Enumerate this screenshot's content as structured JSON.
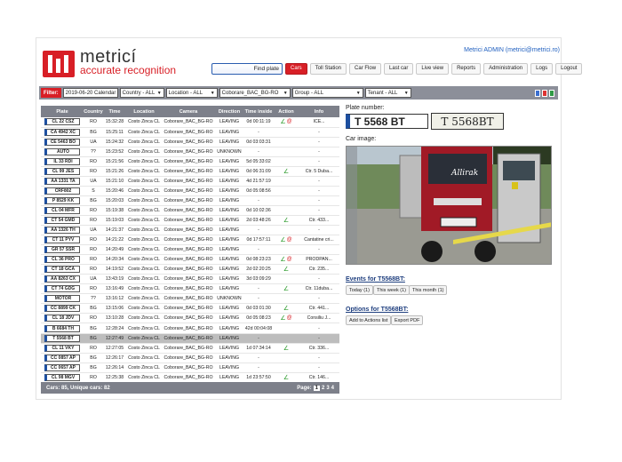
{
  "brand": {
    "name": "metricí",
    "tagline": "accurate recognition"
  },
  "user_link": "Metrici ADMIN (metrici@metrici.ro)",
  "search": {
    "label": "Find plate"
  },
  "nav": [
    "Cars",
    "Toll Station",
    "Car Flow",
    "Last car",
    "Live view",
    "Reports",
    "Administration",
    "Logs",
    "Logout"
  ],
  "filter": {
    "label": "Filter:",
    "date": "2019-06-20 Calendar",
    "country": "Country - ALL",
    "location": "Location - ALL",
    "camera": "Coborare_BAC_BG-RO",
    "group": "Group - ALL",
    "tenant": "Tenant - ALL"
  },
  "table": {
    "headers": [
      "Plate",
      "Country",
      "Time",
      "Location",
      "Camera",
      "Direction",
      "Time inside",
      "Action",
      "Info"
    ],
    "rows": [
      [
        "CL 22 CSZ",
        "RO",
        "15:32:28",
        "Costo Zinca CL",
        "Coborare_BAC_BG-RO",
        "LEAVING",
        "0d 00:11:19",
        "ok-mail",
        "ICE..."
      ],
      [
        "CA 4942 XC",
        "BG",
        "15:25:11",
        "Costo Zinca CL",
        "Coborare_BAC_BG-RO",
        "LEAVING",
        "-",
        "",
        "-"
      ],
      [
        "CE 5463 BO",
        "UA",
        "15:24:32",
        "Costo Zinca CL",
        "Coborare_BAC_BG-RO",
        "LEAVING",
        "0d 03:03:31",
        "",
        "-"
      ],
      [
        "AUTO",
        "??",
        "15:23:52",
        "Costo Zinca CL",
        "Coborare_BAC_BG-RO",
        "UNKNOWN",
        "-",
        "",
        "-"
      ],
      [
        "IL 33 RDI",
        "RO",
        "15:21:56",
        "Costo Zinca CL",
        "Coborare_BAC_BG-RO",
        "LEAVING",
        "5d 05:33:02",
        "",
        "-"
      ],
      [
        "CL 99 JES",
        "RO",
        "15:21:26",
        "Costo Zinca CL",
        "Coborare_BAC_BG-RO",
        "LEAVING",
        "0d 06:31:09",
        "ok",
        "Ctr. 5 Duba..."
      ],
      [
        "AA 1331 TA",
        "UA",
        "15:21:10",
        "Costo Zinca CL",
        "Coborare_BAC_BG-RO",
        "LEAVING",
        "4d 21:57:19",
        "",
        "-"
      ],
      [
        "CRF802",
        "S",
        "15:20:46",
        "Costo Zinca CL",
        "Coborare_BAC_BG-RO",
        "LEAVING",
        "0d 05:08:56",
        "",
        "-"
      ],
      [
        "P 8529 KK",
        "BG",
        "15:20:03",
        "Costo Zinca CL",
        "Coborare_BAC_BG-RO",
        "LEAVING",
        "-",
        "",
        "-"
      ],
      [
        "CL 04 MFR",
        "RO",
        "15:19:38",
        "Costo Zinca CL",
        "Coborare_BAC_BG-RO",
        "LEAVING",
        "0d 10:02:36",
        "",
        "-"
      ],
      [
        "CT 54 GMD",
        "RO",
        "15:19:03",
        "Costo Zinca CL",
        "Coborare_BAC_BG-RO",
        "LEAVING",
        "2d 03:48:26",
        "ok",
        "Ctr. 433..."
      ],
      [
        "AA 1326 TH",
        "UA",
        "14:21:37",
        "Costo Zinca CL",
        "Coborare_BAC_BG-RO",
        "LEAVING",
        "-",
        "",
        "-"
      ],
      [
        "CT 11 PYV",
        "RO",
        "14:21:22",
        "Costo Zinca CL",
        "Coborare_BAC_BG-RO",
        "LEAVING",
        "0d 17:57:11",
        "ok-mail",
        "Cantatine cri..."
      ],
      [
        "GR 57 SSR",
        "RO",
        "14:20:49",
        "Costo Zinca CL",
        "Coborare_BAC_BG-RO",
        "LEAVING",
        "-",
        "",
        "-"
      ],
      [
        "CL 36 PRO",
        "RO",
        "14:20:34",
        "Costo Zinca CL",
        "Coborare_BAC_BG-RO",
        "LEAVING",
        "0d 08:23:23",
        "ok-mail",
        "PRODPAN..."
      ],
      [
        "CT 18 GCA",
        "RO",
        "14:19:52",
        "Costo Zinca CL",
        "Coborare_BAC_BG-RO",
        "LEAVING",
        "2d 02:20:25",
        "ok",
        "Ctr. 235..."
      ],
      [
        "AA 8263 CX",
        "UA",
        "13:43:19",
        "Costo Zinca CL",
        "Coborare_BAC_BG-RO",
        "LEAVING",
        "3d 03:09:29",
        "",
        "-"
      ],
      [
        "CT 74 GDG",
        "RO",
        "13:16:49",
        "Costo Zinca CL",
        "Coborare_BAC_BG-RO",
        "LEAVING",
        "-",
        "ok",
        "Ctr. 11duba..."
      ],
      [
        "MOTOR",
        "??",
        "13:16:12",
        "Costo Zinca CL",
        "Coborare_BAC_BG-RO",
        "UNKNOWN",
        "-",
        "",
        "-"
      ],
      [
        "CC 8899 CK",
        "BG",
        "13:15:06",
        "Costo Zinca CL",
        "Coborare_BAC_BG-RO",
        "LEAVING",
        "0d 03:01:30",
        "ok",
        "Ctr. 441..."
      ],
      [
        "CL 18 JDV",
        "RO",
        "13:10:28",
        "Costo Zinca CL",
        "Coborare_BAC_BG-RO",
        "LEAVING",
        "0d 05:08:23",
        "ok-mail",
        "Consiliu J..."
      ],
      [
        "B 6684 TH",
        "BG",
        "12:28:24",
        "Costo Zinca CL",
        "Coborare_BAC_BG-RO",
        "LEAVING",
        "42d 00:04:08",
        "",
        "-"
      ],
      [
        "T 5568 BT",
        "BG",
        "12:27:49",
        "Costo Zinca CL",
        "Coborare_BAC_BG-RO",
        "LEAVING",
        "-",
        "",
        "-"
      ],
      [
        "CL 11 VKY",
        "RO",
        "12:27:05",
        "Costo Zinca CL",
        "Coborare_BAC_BG-RO",
        "LEAVING",
        "1d 07:34:14",
        "ok",
        "Ctr. 336..."
      ],
      [
        "CC 0857 AP",
        "BG",
        "12:26:17",
        "Costo Zinca CL",
        "Coborare_BAC_BG-RO",
        "LEAVING",
        "-",
        "",
        "-"
      ],
      [
        "CC 0657 AP",
        "BG",
        "12:26:14",
        "Costo Zinca CL",
        "Coborare_BAC_BG-RO",
        "LEAVING",
        "-",
        "",
        "-"
      ],
      [
        "CL 98 MGV",
        "RO",
        "12:25:38",
        "Costo Zinca CL",
        "Coborare_BAC_BG-RO",
        "LEAVING",
        "1d 23:57:50",
        "ok",
        "Ctr. 146..."
      ]
    ],
    "selected_index": 22,
    "footer": {
      "summary": "Cars: 85, Unique cars: 82",
      "page_label": "Page:",
      "pages": [
        "1",
        "2",
        "3",
        "4"
      ],
      "current_page": "1"
    }
  },
  "detail": {
    "plate_number_label": "Plate number:",
    "plate_text": "T 5568 BT",
    "plate_photo_text": "T 5568BT",
    "car_image_label": "Car image:",
    "truck_brand": "Allirak",
    "events_label": "Events for T5568BT:",
    "event_buttons": [
      "Today (1)",
      "This week (1)",
      "This month (1)"
    ],
    "options_label": "Options for T5568BT:",
    "option_buttons": [
      "Add to Actions list",
      "Export PDF"
    ]
  },
  "colors": {
    "brand_red": "#d81f26",
    "header_gray": "#7d808a",
    "link_blue": "#1f5fbf",
    "plate_blue": "#1d4fa0"
  }
}
